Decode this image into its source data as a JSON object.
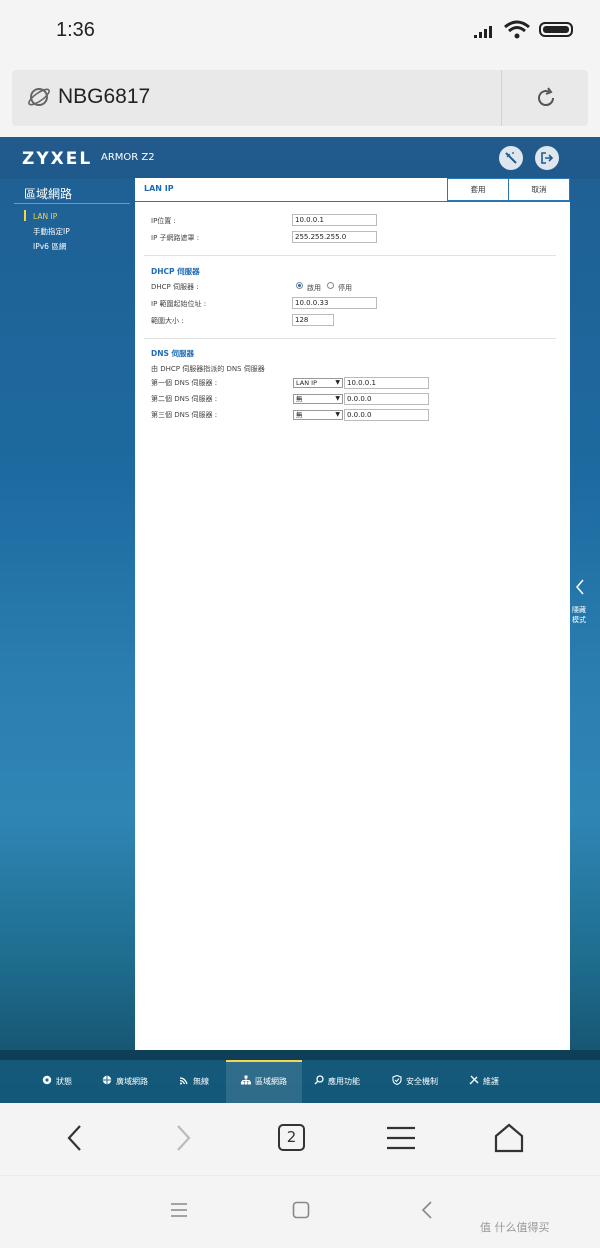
{
  "status": {
    "time": "1:36"
  },
  "browser": {
    "url": "NBG6817",
    "tab_count": "2"
  },
  "router": {
    "brand": "ZYXEL",
    "model": "ARMOR Z2",
    "sidebar": {
      "title": "區域網路",
      "items": [
        {
          "label": "LAN IP",
          "active": true
        },
        {
          "label": "手動指定IP"
        },
        {
          "label": "IPv6 區網"
        }
      ]
    },
    "panel": {
      "title": "LAN IP",
      "apply_label": "套用",
      "cancel_label": "取消",
      "ip_address": {
        "label": "IP位置 :",
        "value": "10.0.0.1"
      },
      "subnet_mask": {
        "label": "IP 子網路遮罩 :",
        "value": "255.255.255.0"
      },
      "dhcp": {
        "title": "DHCP 伺服器",
        "server_label": "DHCP 伺服器 :",
        "enable_label": "啟用",
        "disable_label": "停用",
        "selected": "啟用",
        "start_label": "IP 範圍起始位址 :",
        "start_value": "10.0.0.33",
        "size_label": "範圍大小 :",
        "size_value": "128"
      },
      "dns": {
        "title": "DNS 伺服器",
        "desc": "由 DHCP 伺服器指派的 DNS 伺服器",
        "rows": [
          {
            "label": "第一個 DNS 伺服器 :",
            "select": "LAN IP",
            "value": "10.0.0.1"
          },
          {
            "label": "第二個 DNS 伺服器 :",
            "select": "無",
            "value": "0.0.0.0"
          },
          {
            "label": "第三個 DNS 伺服器 :",
            "select": "無",
            "value": "0.0.0.0"
          }
        ]
      }
    },
    "hide_mode": "隱藏模式",
    "bottom_nav": [
      {
        "label": "狀態",
        "icon": "status-icon"
      },
      {
        "label": "廣域網路",
        "icon": "globe-icon"
      },
      {
        "label": "無線",
        "icon": "wifi-icon"
      },
      {
        "label": "區域網路",
        "icon": "lan-icon",
        "active": true
      },
      {
        "label": "應用功能",
        "icon": "apps-icon"
      },
      {
        "label": "安全機制",
        "icon": "shield-icon"
      },
      {
        "label": "維護",
        "icon": "tools-icon"
      }
    ]
  },
  "watermark": "值 什么值得买",
  "colors": {
    "accent": "#1f6bb5",
    "active_nav": "#f7d54a",
    "header": "#1f5a8d"
  }
}
